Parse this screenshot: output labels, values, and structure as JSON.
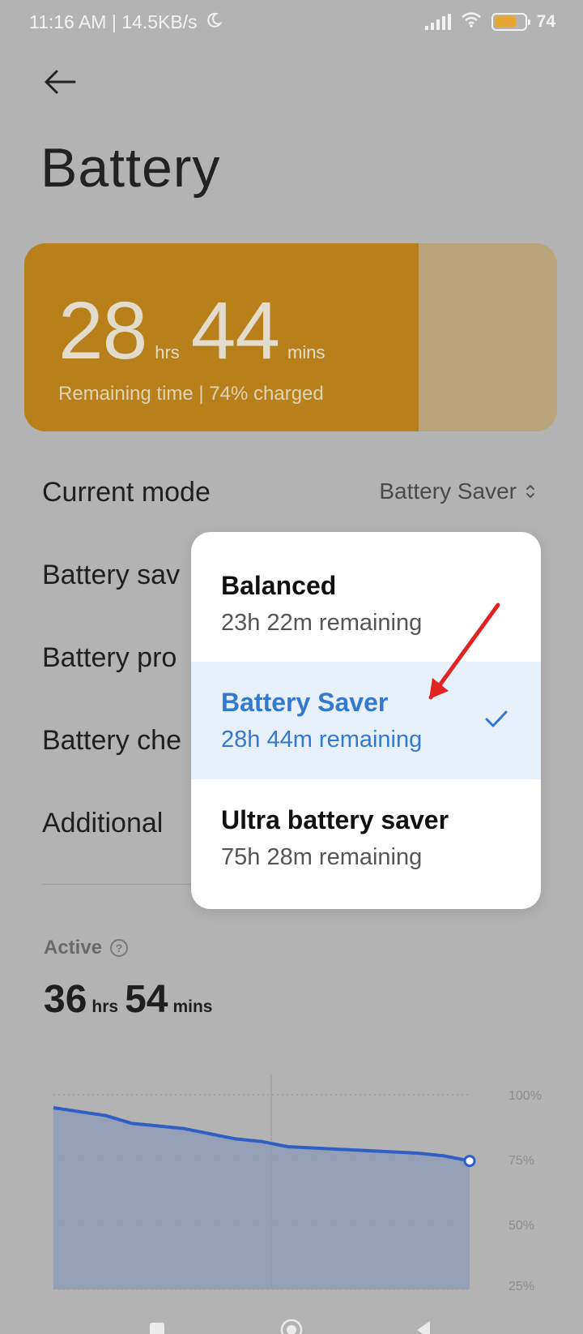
{
  "status_bar": {
    "left_text": "11:16 AM | 14.5KB/s",
    "battery_percent": "74"
  },
  "header": {
    "title": "Battery"
  },
  "card": {
    "hours": "28",
    "hours_unit": "hrs",
    "minutes": "44",
    "minutes_unit": "mins",
    "subtitle": "Remaining time | 74% charged",
    "charge_fraction": 0.74
  },
  "settings": {
    "current_mode_label": "Current mode",
    "current_mode_value": "Battery Saver",
    "rows": [
      "Battery sav",
      "Battery pro",
      "Battery che",
      "Additional"
    ]
  },
  "active": {
    "label": "Active",
    "hours": "36",
    "hours_unit": "hrs",
    "minutes": "54",
    "minutes_unit": "mins"
  },
  "chart_data": {
    "type": "area",
    "y_ticks": [
      "100%",
      "75%",
      "50%",
      "25%"
    ],
    "ylim": [
      25,
      100
    ],
    "grid": true,
    "series": [
      {
        "values": [
          95,
          93.5,
          92,
          89,
          88,
          87,
          85,
          83,
          82,
          80,
          79.5,
          79,
          78.5,
          78,
          77.5,
          76.5,
          74.5
        ]
      }
    ]
  },
  "mode_menu": {
    "options": [
      {
        "title": "Balanced",
        "subtitle": "23h 22m remaining",
        "selected": false
      },
      {
        "title": "Battery Saver",
        "subtitle": "28h 44m remaining",
        "selected": true
      },
      {
        "title": "Ultra battery saver",
        "subtitle": "75h 28m remaining",
        "selected": false
      }
    ]
  },
  "colors": {
    "card_fill": "#b7801a",
    "card_empty": "#b9a47c",
    "accent_blue": "#3479d0",
    "chart_line": "#2f5fc4",
    "annotation_arrow": "#e02424"
  },
  "icons": {
    "back": "arrow-left-icon",
    "moon": "moon-icon",
    "signal": "signal-icon",
    "wifi": "wifi-icon",
    "battery": "battery-icon",
    "selector": "up-down-chevron-icon",
    "help": "question-circle-icon",
    "check": "check-icon",
    "nav_recents": "square-icon",
    "nav_home": "circle-icon",
    "nav_back": "triangle-back-icon"
  }
}
